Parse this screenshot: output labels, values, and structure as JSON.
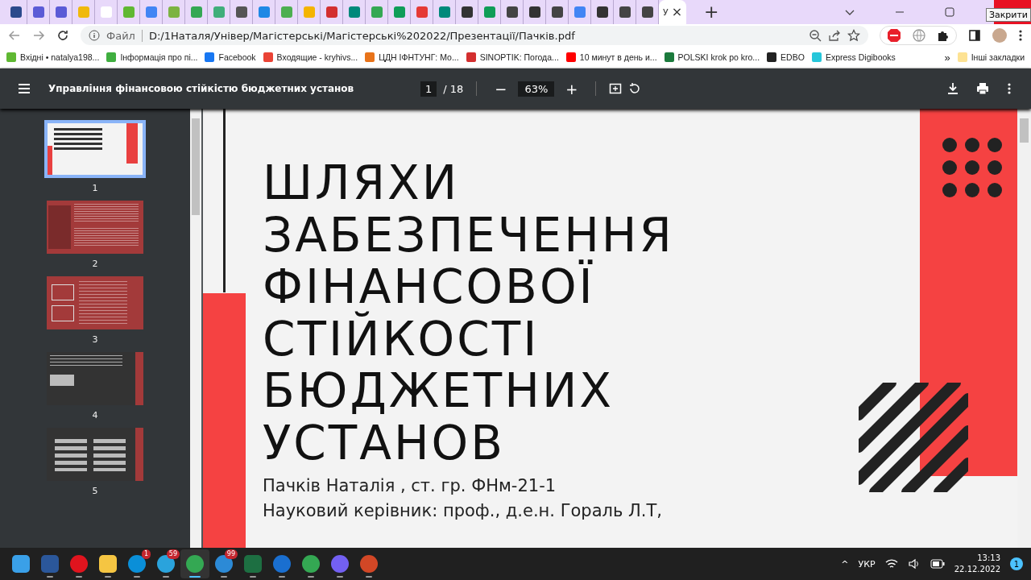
{
  "tabs": [
    {
      "color": "#2b4a8c",
      "selected": false
    },
    {
      "color": "#5b5bd6",
      "selected": false
    },
    {
      "color": "#5b5bd6",
      "selected": false
    },
    {
      "color": "#f0b90b",
      "selected": false
    },
    {
      "color": "#ffffff",
      "selected": false
    },
    {
      "color": "#5fb832",
      "selected": false
    },
    {
      "color": "#4285f4",
      "selected": false
    },
    {
      "color": "#7cb342",
      "selected": false
    },
    {
      "color": "#34a853",
      "selected": false
    },
    {
      "color": "#3fae7a",
      "selected": false
    },
    {
      "color": "#555555",
      "selected": false
    },
    {
      "color": "#1e88e5",
      "selected": false
    },
    {
      "color": "#4caf50",
      "selected": false
    },
    {
      "color": "#f4b400",
      "selected": false
    },
    {
      "color": "#d32f2f",
      "selected": false
    },
    {
      "color": "#00897b",
      "selected": false
    },
    {
      "color": "#34a853",
      "selected": false
    },
    {
      "color": "#0f9d58",
      "selected": false
    },
    {
      "color": "#e53935",
      "selected": false
    },
    {
      "color": "#00897b",
      "selected": false
    },
    {
      "color": "#333333",
      "selected": false
    },
    {
      "color": "#0f9d58",
      "selected": false
    },
    {
      "color": "#444444",
      "selected": false
    },
    {
      "color": "#333333",
      "selected": false
    },
    {
      "color": "#444444",
      "selected": false
    },
    {
      "color": "#4285f4",
      "selected": false
    },
    {
      "color": "#333333",
      "selected": false
    },
    {
      "color": "#444444",
      "selected": false
    },
    {
      "color": "#444444",
      "selected": false
    },
    {
      "selected": true,
      "title": "У",
      "close": "×"
    }
  ],
  "new_tab": "+",
  "tooltip": "Закрити",
  "address": {
    "scheme": "Файл",
    "url": "D:/1Наталя/Універ/Магістерські/Магістерські%202022/Презентації/Пачків.pdf"
  },
  "bookmarks": [
    {
      "label": "Вхідні • natalya198...",
      "color": "#5fb832"
    },
    {
      "label": "Інформація про пі...",
      "color": "#3fae3f"
    },
    {
      "label": "Facebook",
      "color": "#1877f2"
    },
    {
      "label": "Входящие - kryhivs...",
      "color": "#ea4335"
    },
    {
      "label": "ЦДН ІФНТУНГ: Мо...",
      "color": "#e8731a"
    },
    {
      "label": "SINOPTIK: Погода...",
      "color": "#d32f2f"
    },
    {
      "label": "10 минут в день и...",
      "color": "#ff0000"
    },
    {
      "label": "POLSKI krok po kro...",
      "color": "#1b7a3c"
    },
    {
      "label": "EDBO",
      "color": "#222222"
    },
    {
      "label": "Express Digibooks",
      "color": "#26c6da"
    }
  ],
  "more_bookmarks": "»",
  "other_bookmarks": "Інші закладки",
  "pdf": {
    "title": "Управління фінансовою стійкістю бюджетних установ",
    "page": "1",
    "pages": "/ 18",
    "zoom_out": "−",
    "zoom": "63%",
    "zoom_in": "+"
  },
  "thumbnails": [
    {
      "kind": "title",
      "label": "1",
      "selected": true
    },
    {
      "kind": "text",
      "label": "2",
      "selected": false
    },
    {
      "kind": "diagram",
      "label": "3",
      "selected": false
    },
    {
      "kind": "dark",
      "label": "4",
      "selected": false
    },
    {
      "kind": "table",
      "label": "5",
      "selected": false
    }
  ],
  "slide": {
    "title": [
      "ШЛЯХИ",
      "ЗАБЕЗПЕЧЕННЯ",
      "ФІНАНСОВОЇ",
      "СТІЙКОСТІ",
      "БЮДЖЕТНИХ",
      "УСТАНОВ"
    ],
    "lines": [
      "Пачків Наталія , ст. гр. ФНм-21-1",
      "Науковий керівник:  проф., д.е.н. Гораль Л.Т,"
    ]
  },
  "taskbar": [
    {
      "kind": "start",
      "running": false,
      "active": false
    },
    {
      "kind": "word",
      "running": true,
      "active": false
    },
    {
      "kind": "opera",
      "running": true,
      "active": false
    },
    {
      "kind": "folder",
      "running": true,
      "active": false
    },
    {
      "kind": "skype",
      "running": true,
      "active": false,
      "badge": "1"
    },
    {
      "kind": "telegram",
      "running": true,
      "active": false,
      "badge": "59"
    },
    {
      "kind": "chrome",
      "running": true,
      "active": true
    },
    {
      "kind": "calendar",
      "running": true,
      "active": false,
      "badge": "99"
    },
    {
      "kind": "excel",
      "running": true,
      "active": false
    },
    {
      "kind": "mail",
      "running": true,
      "active": false
    },
    {
      "kind": "chrome",
      "running": true,
      "active": false
    },
    {
      "kind": "viber",
      "running": true,
      "active": false
    },
    {
      "kind": "powerpoint",
      "running": true,
      "active": false
    }
  ],
  "tray": {
    "caret": "^",
    "language": "УКР",
    "time": "13:13",
    "date": "22.12.2022",
    "notifications": "1"
  }
}
